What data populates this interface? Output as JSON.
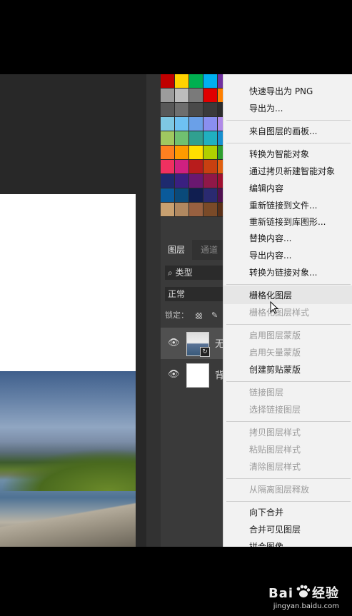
{
  "colors": {
    "swatches": [
      "#c00000",
      "#ffd200",
      "#00b050",
      "#00b0f0",
      "#7030a0",
      "#9c9c9c",
      "#bdbdbd",
      "#7a7a7a",
      "#e00000",
      "#ff8000",
      "#585858",
      "#6e6e6e",
      "#4a4a4a",
      "#3a3a3a",
      "#2c2c2c",
      "#7ec8e3",
      "#6ec1f2",
      "#6aa0e8",
      "#8a8ff0",
      "#b08ae8",
      "#a0c860",
      "#70c070",
      "#30a090",
      "#20b0c0",
      "#1890d0",
      "#ff8020",
      "#ff9a00",
      "#ffe000",
      "#b0d000",
      "#30a030",
      "#f03060",
      "#d02080",
      "#b81c1c",
      "#c84010",
      "#e06010",
      "#1e2a6e",
      "#3a2080",
      "#6a1870",
      "#901848",
      "#a01030",
      "#0a5a9a",
      "#0a4a7a",
      "#101e50",
      "#2a2a70",
      "#501050",
      "#c8a070",
      "#b08860",
      "#986040",
      "#7a4a28",
      "#5a3018"
    ]
  },
  "panel": {
    "tabs": {
      "layers": "图层",
      "channels": "通道"
    },
    "search_label": "类型",
    "blend_mode": "正常",
    "lock_label": "锁定：",
    "layers": [
      {
        "name": "无",
        "visible_icon": "eye-icon",
        "thumb": "smart-object"
      },
      {
        "name": "背",
        "visible_icon": "eye-icon",
        "thumb": "white"
      }
    ]
  },
  "context_menu": {
    "items": [
      {
        "label": "快速导出为 PNG",
        "disabled": false
      },
      {
        "label": "导出为...",
        "disabled": false
      },
      {
        "label": "来自图层的画板...",
        "disabled": false
      },
      {
        "label": "转换为智能对象",
        "disabled": false
      },
      {
        "label": "通过拷贝新建智能对象",
        "disabled": false
      },
      {
        "label": "编辑内容",
        "disabled": false
      },
      {
        "label": "重新链接到文件...",
        "disabled": false
      },
      {
        "label": "重新链接到库图形...",
        "disabled": false
      },
      {
        "label": "替换内容...",
        "disabled": false
      },
      {
        "label": "导出内容...",
        "disabled": false
      },
      {
        "label": "转换为链接对象...",
        "disabled": false
      },
      {
        "label": "栅格化图层",
        "disabled": false
      },
      {
        "label": "栅格化图层样式",
        "disabled": true
      },
      {
        "label": "启用图层蒙版",
        "disabled": true
      },
      {
        "label": "启用矢量蒙版",
        "disabled": true
      },
      {
        "label": "创建剪贴蒙版",
        "disabled": false
      },
      {
        "label": "链接图层",
        "disabled": true
      },
      {
        "label": "选择链接图层",
        "disabled": true
      },
      {
        "label": "拷贝图层样式",
        "disabled": true
      },
      {
        "label": "粘贴图层样式",
        "disabled": true
      },
      {
        "label": "清除图层样式",
        "disabled": true
      },
      {
        "label": "从隔离图层释放",
        "disabled": true
      },
      {
        "label": "向下合并",
        "disabled": false
      },
      {
        "label": "合并可见图层",
        "disabled": false
      },
      {
        "label": "拼合图像",
        "disabled": false
      }
    ]
  },
  "watermark": {
    "brand": "Bai",
    "brand_suffix": "经验",
    "site": "jingyan.baidu.com"
  }
}
